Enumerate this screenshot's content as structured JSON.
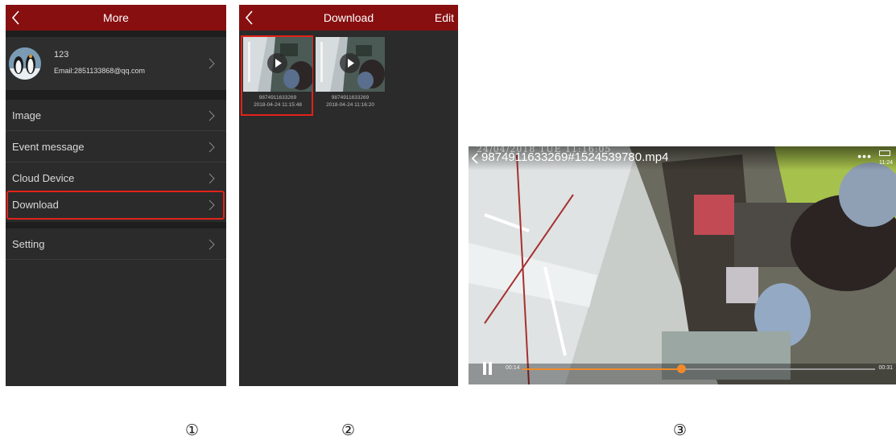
{
  "screen1": {
    "title": "More",
    "profile": {
      "name": "123",
      "email": "Email:2851133868@qq.com"
    },
    "menu": [
      {
        "label": "Image"
      },
      {
        "label": "Event message"
      },
      {
        "label": "Cloud Device"
      },
      {
        "label": "Download",
        "highlighted": true
      },
      {
        "label": "Setting"
      }
    ],
    "icons": {
      "back": "chevron-left-icon",
      "row": "chevron-right-icon",
      "avatar": "penguin-avatar"
    }
  },
  "screen2": {
    "title": "Download",
    "edit_label": "Edit",
    "videos": [
      {
        "id": "9874911633269",
        "datetime": "2018-04-24 11:15:48",
        "selected": true
      },
      {
        "id": "9874911633269",
        "datetime": "2018-04-24 11:16:20",
        "selected": false
      }
    ],
    "icons": {
      "back": "chevron-left-icon",
      "play": "play-icon"
    }
  },
  "screen3": {
    "filename": "9874911633269#1524539780.mp4",
    "osd_timestamp": "24/04/2018 TUE 11:16:05",
    "menu_icon": "more-dots-icon",
    "status_time": "11:24",
    "current_time": "00:14",
    "total_time": "00:31",
    "progress_fraction": 0.45,
    "playing": true
  },
  "step_labels": [
    "①",
    "②",
    "③"
  ],
  "colors": {
    "accent": "#870f10",
    "highlight": "#e2231a",
    "progress": "#f08a2a",
    "background": "#2b2b2b"
  }
}
